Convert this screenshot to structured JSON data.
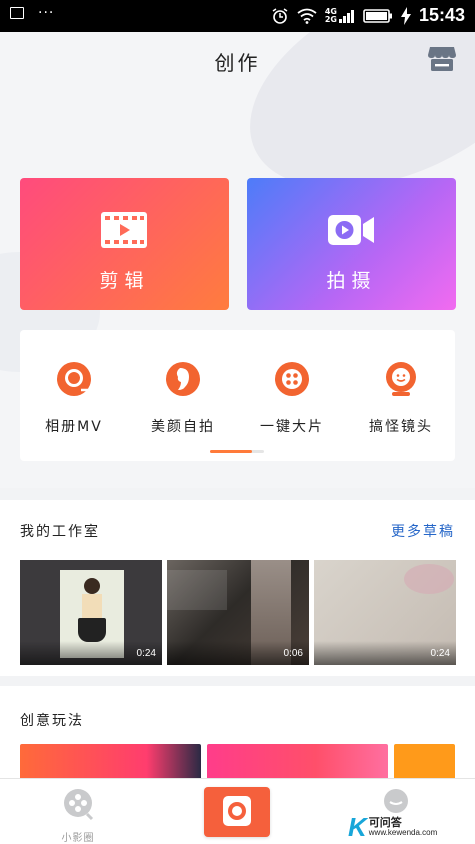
{
  "status_bar": {
    "network": "4G",
    "network2": "2G",
    "time": "15:43"
  },
  "header": {
    "title": "创作",
    "store_icon": "store-icon"
  },
  "main_actions": [
    {
      "label": "剪辑",
      "icon": "film-icon"
    },
    {
      "label": "拍摄",
      "icon": "video-camera-icon"
    }
  ],
  "tools": [
    {
      "label": "相册MV",
      "icon": "album-mv-icon"
    },
    {
      "label": "美颜自拍",
      "icon": "beauty-selfie-icon"
    },
    {
      "label": "一键大片",
      "icon": "one-click-movie-icon"
    },
    {
      "label": "搞怪镜头",
      "icon": "funny-lens-icon"
    }
  ],
  "tools_pager": {
    "pages": 2,
    "current": 1
  },
  "studio": {
    "title": "我的工作室",
    "more_label": "更多草稿",
    "drafts": [
      {
        "duration": "0:24"
      },
      {
        "duration": "0:06"
      },
      {
        "duration": "0:24"
      }
    ]
  },
  "creative": {
    "title": "创意玩法"
  },
  "bottom_nav": {
    "left_label": "小影圈",
    "center_icon": "camera-icon",
    "right_icon": "profile-icon"
  },
  "watermark": {
    "letter": "K",
    "text": "可问答",
    "url": "www.kewenda.com"
  },
  "colors": {
    "accent": "#ff7a3a",
    "link": "#2566c8",
    "camera_button": "#f5603c"
  }
}
